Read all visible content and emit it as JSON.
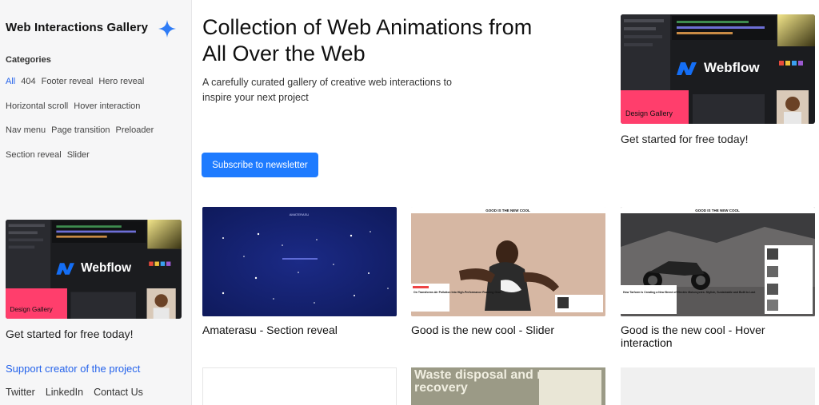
{
  "sidebar": {
    "title": "Web Interactions Gallery",
    "categories_heading": "Categories",
    "category_rows": [
      [
        "All",
        "404",
        "Footer reveal",
        "Hero reveal"
      ],
      [
        "Horizontal scroll",
        "Hover interaction"
      ],
      [
        "Nav menu",
        "Page transition",
        "Preloader"
      ],
      [
        "Section reveal",
        "Slider"
      ]
    ],
    "active_category": "All",
    "promo_logo": "Webflow",
    "promo_card_text": "Design Gallery",
    "promo_caption": "Get started for free today!",
    "support_link": "Support creator of the project",
    "social": [
      "Twitter",
      "LinkedIn",
      "Contact Us"
    ]
  },
  "hero": {
    "title": "Collection of Web Animations from All Over the Web",
    "subtitle": "A carefully curated gallery of creative web interactions to inspire your next project",
    "subscribe_label": "Subscribe to newsletter"
  },
  "promo_top": {
    "logo": "Webflow",
    "card_text": "Design Gallery",
    "caption": "Get started for free today!"
  },
  "cards": [
    {
      "title": "Amaterasu - Section reveal",
      "thumb_label": "AMATERASU"
    },
    {
      "title": "Good is the new cool - Slider",
      "thumb_label": "GOOD IS THE NEW COOL",
      "thumb_headline": "On Transforms Air Pollution Into High-Performance Running Gear"
    },
    {
      "title": "Good is the new cool - Hover interaction",
      "thumb_label": "GOOD IS THE NEW COOL",
      "thumb_headline": "How Tarform Is Creating a New Breed of Electric Motorcycles: Stylish, Sustainable and Built to Last"
    }
  ],
  "row2": {
    "card2_text": "Waste disposal and resource recovery"
  },
  "colors": {
    "accent": "#1e7bff",
    "link": "#2563eb",
    "sidebar_bg": "#f6f6f7",
    "star": "#2f7cf6",
    "webflow_blue": "#146ef5"
  }
}
